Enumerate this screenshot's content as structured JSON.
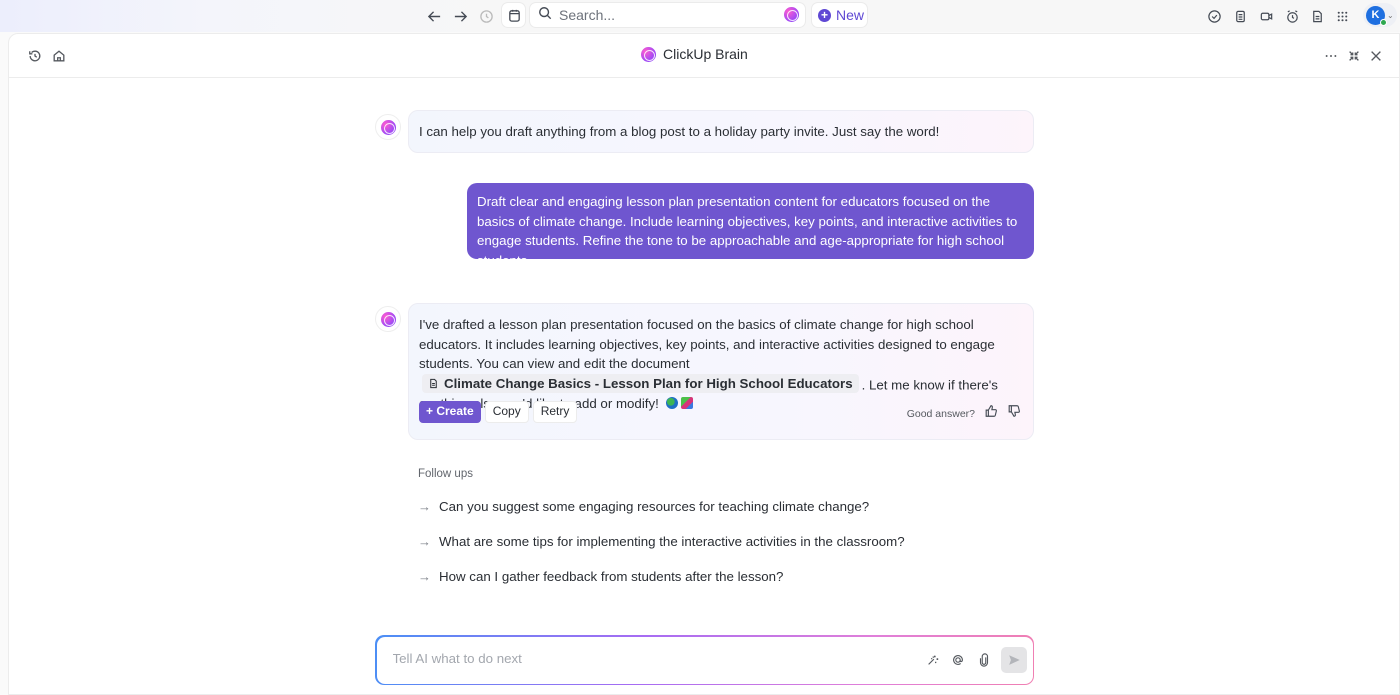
{
  "topbar": {
    "search_placeholder": "Search...",
    "new_label": "New",
    "avatar_initial": "K",
    "icons": [
      "arrow-left-icon",
      "arrow-right-icon",
      "history-icon",
      "calendar-icon",
      "search-icon",
      "brain-icon",
      "plus-circle-icon",
      "check-circle-icon",
      "notepad-icon",
      "video-icon",
      "alarm-clock-icon",
      "document-icon",
      "apps-grid-icon"
    ]
  },
  "panel": {
    "title": "ClickUp Brain",
    "left_icons": [
      "history-icon",
      "home-icon"
    ],
    "right_icons": [
      "more-icon",
      "collapse-icon",
      "close-icon"
    ]
  },
  "chat": {
    "greeting": "I can help you draft anything from a blog post to a holiday party invite. Just say the word!",
    "user_message": "Draft clear and engaging lesson plan presentation content for educators focused on the basics of climate change. Include learning objectives, key points, and interactive activities to engage students. Refine the tone to be approachable and age-appropriate for high school students.",
    "response": {
      "text_before": "I've drafted a lesson plan presentation focused on the basics of climate change for high school educators. It includes learning objectives, key points, and interactive activities designed to engage students. You can view and edit the document",
      "doc_link": "Climate Change Basics - Lesson Plan for High School Educators",
      "text_after": ". Let me know if there's anything else you'd like to add or modify!",
      "emojis": [
        "globe-emoji",
        "books-emoji"
      ],
      "create_label": "+ Create",
      "copy_label": "Copy",
      "retry_label": "Retry",
      "feedback_prompt": "Good answer?"
    }
  },
  "followups": {
    "label": "Follow ups",
    "items": [
      "Can you suggest some engaging resources for teaching climate change?",
      "What are some tips for implementing the interactive activities in the classroom?",
      "How can I gather feedback from students after the lesson?"
    ]
  },
  "composer": {
    "placeholder": "Tell AI what to do next",
    "value": ""
  },
  "colors": {
    "accent": "#6f56cf",
    "new_button": "#5f48d4",
    "avatar": "#1e6fe0",
    "online": "#2fa84f"
  }
}
